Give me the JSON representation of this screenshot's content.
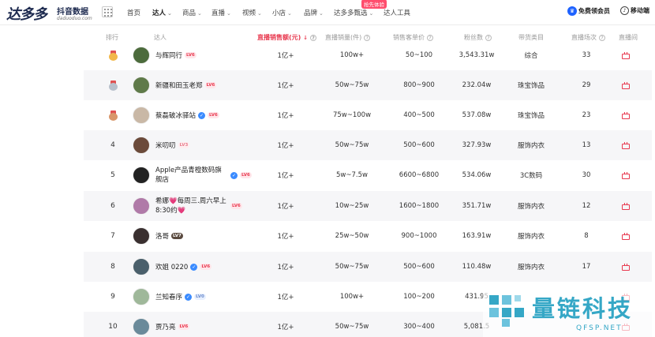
{
  "brand": {
    "name": "达多多",
    "tag": "抖音数据",
    "domain": "daduoduo.com"
  },
  "nav": {
    "items": [
      {
        "label": "首页",
        "active": false,
        "dropdown": false
      },
      {
        "label": "达人",
        "active": true,
        "dropdown": true
      },
      {
        "label": "商品",
        "active": false,
        "dropdown": true
      },
      {
        "label": "直播",
        "active": false,
        "dropdown": true
      },
      {
        "label": "视频",
        "active": false,
        "dropdown": true
      },
      {
        "label": "小店",
        "active": false,
        "dropdown": true
      },
      {
        "label": "品牌",
        "active": false,
        "dropdown": true
      },
      {
        "label": "达多多甄选",
        "active": false,
        "dropdown": true
      },
      {
        "label": "达人工具",
        "active": false,
        "dropdown": false
      }
    ],
    "hot_badge": "抢先体验",
    "member_button": "免费领会员",
    "mobile_button": "移动端"
  },
  "table": {
    "headers": {
      "rank": "排行",
      "talent": "达人",
      "live_sales": "直播销售额(元)",
      "live_volume": "直播销量(件)",
      "avg_price": "销售客单价",
      "fans": "粉丝数",
      "category": "带货类目",
      "live_count": "直播场次",
      "live_room": "直播间"
    },
    "rows": [
      {
        "rank": "1",
        "medal": "gold",
        "name": "与辉同行",
        "verified": false,
        "level": "LV6",
        "level_style": "red",
        "sales": "1亿+",
        "volume": "100w+",
        "price": "50~100",
        "fans": "3,543.31w",
        "category": "综合",
        "count": "33",
        "avatar_color": "#4c6b3c"
      },
      {
        "rank": "2",
        "medal": "silver",
        "name": "新疆和田玉老郑",
        "verified": false,
        "level": "LV6",
        "level_style": "red",
        "sales": "1亿+",
        "volume": "50w~75w",
        "price": "800~900",
        "fans": "232.04w",
        "category": "珠宝饰品",
        "count": "29",
        "avatar_color": "#5f7a4a"
      },
      {
        "rank": "3",
        "medal": "bronze",
        "name": "蔡磊破冰驿站",
        "verified": true,
        "level": "LV6",
        "level_style": "red",
        "sales": "1亿+",
        "volume": "75w~100w",
        "price": "400~500",
        "fans": "537.08w",
        "category": "珠宝饰品",
        "count": "23",
        "avatar_color": "#c9b8a6"
      },
      {
        "rank": "4",
        "medal": "",
        "name": "米叨叨",
        "verified": false,
        "level": "LV3",
        "level_style": "pink",
        "sales": "1亿+",
        "volume": "50w~75w",
        "price": "500~600",
        "fans": "327.93w",
        "category": "服饰内衣",
        "count": "13",
        "avatar_color": "#6b4a3a"
      },
      {
        "rank": "5",
        "medal": "",
        "name": "Apple产品青橙数码旗舰店",
        "verified": true,
        "level": "LV6",
        "level_style": "red",
        "sales": "1亿+",
        "volume": "5w~7.5w",
        "price": "6600~6800",
        "fans": "534.06w",
        "category": "3C数码",
        "count": "30",
        "avatar_color": "#222222"
      },
      {
        "rank": "6",
        "medal": "",
        "name": "希娜💗每周三.周六早上8:30约💗",
        "verified": false,
        "level": "LV6",
        "level_style": "red",
        "sales": "1亿+",
        "volume": "10w~25w",
        "price": "1600~1800",
        "fans": "351.71w",
        "category": "服饰内衣",
        "count": "12",
        "avatar_color": "#b07aa8"
      },
      {
        "rank": "7",
        "medal": "",
        "name": "洛哥",
        "verified": false,
        "level": "LV7",
        "level_style": "dark",
        "sales": "1亿+",
        "volume": "25w~50w",
        "price": "900~1000",
        "fans": "163.91w",
        "category": "服饰内衣",
        "count": "8",
        "avatar_color": "#3a3030"
      },
      {
        "rank": "8",
        "medal": "",
        "name": "欢姐 0220",
        "verified": true,
        "level": "LV6",
        "level_style": "red",
        "sales": "1亿+",
        "volume": "50w~75w",
        "price": "500~600",
        "fans": "110.48w",
        "category": "服饰内衣",
        "count": "17",
        "avatar_color": "#4a5f6b"
      },
      {
        "rank": "9",
        "medal": "",
        "name": "兰知春序",
        "verified": true,
        "level": "LV0",
        "level_style": "blue",
        "sales": "1亿+",
        "volume": "100w+",
        "price": "100~200",
        "fans": "431.95",
        "category": "",
        "count": "",
        "avatar_color": "#9fb89a"
      },
      {
        "rank": "10",
        "medal": "",
        "name": "贾乃亮",
        "verified": false,
        "level": "LV6",
        "level_style": "red",
        "sales": "1亿+",
        "volume": "50w~75w",
        "price": "300~400",
        "fans": "5,081.5",
        "category": "",
        "count": "",
        "avatar_color": "#6a8a9a"
      }
    ]
  },
  "watermark": {
    "text": "量链科技",
    "sub": "QFSP.NET"
  },
  "colors": {
    "accent": "#e8394f",
    "brand": "#1d2a4f",
    "verified": "#3a8bff",
    "watermark": "#35a7c6"
  }
}
